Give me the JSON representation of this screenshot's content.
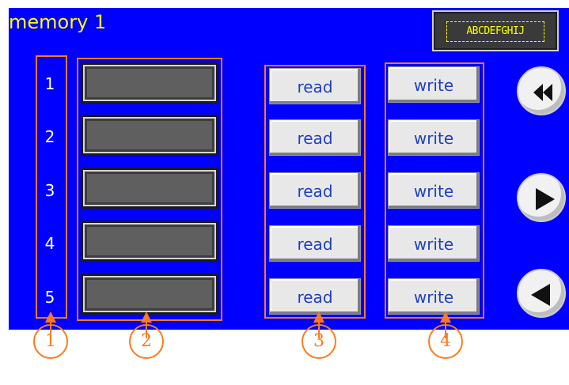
{
  "screen": {
    "title": "memory 1",
    "text_display": "ABCDEFGHIJ",
    "rows": [
      {
        "number": "1",
        "read": "read",
        "write": "write"
      },
      {
        "number": "2",
        "read": "read",
        "write": "write"
      },
      {
        "number": "3",
        "read": "read",
        "write": "write"
      },
      {
        "number": "4",
        "read": "read",
        "write": "write"
      },
      {
        "number": "5",
        "read": "read",
        "write": "write"
      }
    ],
    "nav": [
      "rewind-icon",
      "play-right-icon",
      "play-left-icon"
    ]
  },
  "callouts": [
    "1",
    "2",
    "3",
    "4"
  ],
  "colors": {
    "background": "#0000ff",
    "title": "#ffff00",
    "callout": "#ff7a1a",
    "button_text": "#1f3fc4"
  }
}
